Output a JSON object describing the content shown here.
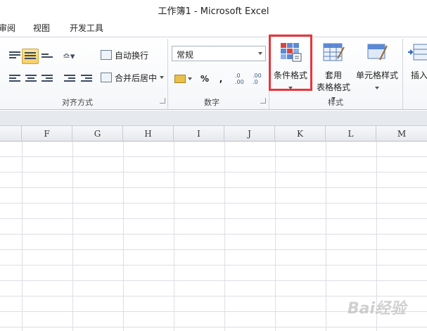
{
  "window": {
    "title": "工作簿1 - Microsoft Excel"
  },
  "tabs": [
    "审阅",
    "视图",
    "开发工具"
  ],
  "alignment": {
    "wrap_text": "自动换行",
    "merge_center": "合并后居中",
    "group_label": "对齐方式"
  },
  "number": {
    "format_value": "常规",
    "percent": "%",
    "comma": ",",
    "inc_decimal": ".0 .00",
    "dec_decimal": ".00 .0",
    "group_label": "数字"
  },
  "styles": {
    "conditional_formatting": "条件格式",
    "format_as_table_line1": "套用",
    "format_as_table_line2": "表格格式",
    "cell_styles": "单元格样式",
    "group_label": "样式"
  },
  "cells": {
    "insert": "插入"
  },
  "columns": [
    "F",
    "G",
    "H",
    "I",
    "J",
    "K",
    "L",
    "M"
  ],
  "watermark": "Bai经验"
}
